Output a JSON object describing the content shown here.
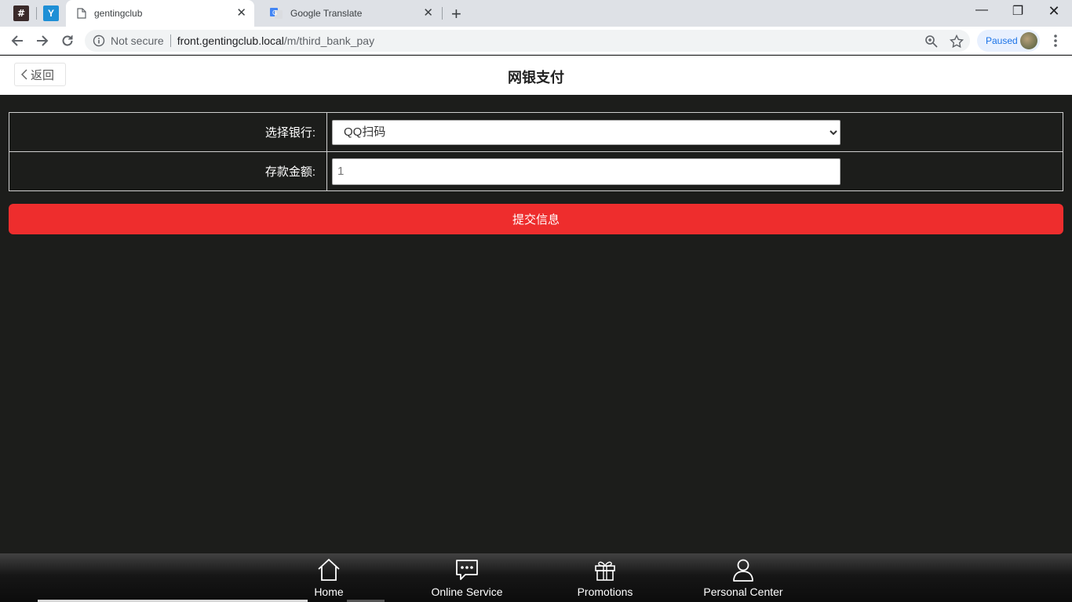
{
  "browser": {
    "pinned_tabs": [
      {
        "icon": "hash-icon",
        "glyph": "#"
      },
      {
        "icon": "y-logo-icon",
        "glyph": "Y"
      }
    ],
    "tabs": [
      {
        "title": "gentingclub",
        "icon": "page-icon",
        "active": true
      },
      {
        "title": "Google Translate",
        "icon": "google-translate-icon",
        "active": false
      }
    ],
    "address": {
      "security_label": "Not secure",
      "url_host": "front.gentingclub.local",
      "url_path": "/m/third_bank_pay"
    },
    "profile": {
      "status": "Paused"
    }
  },
  "header": {
    "back_label": "返回",
    "title": "网银支付"
  },
  "form": {
    "bank_label": "选择银行:",
    "bank_selected": "QQ扫码",
    "amount_label": "存款金额:",
    "amount_value": "1"
  },
  "submit_label": "提交信息",
  "bottom_nav": {
    "items": [
      {
        "label": "Home",
        "icon": "home-icon"
      },
      {
        "label": "Online Service",
        "icon": "chat-icon"
      },
      {
        "label": "Promotions",
        "icon": "gift-icon"
      },
      {
        "label": "Personal Center",
        "icon": "user-icon"
      }
    ]
  },
  "colors": {
    "page_bg": "#1c1d1b",
    "submit_bg": "#ee2d2d",
    "header_bg": "#ffffff"
  }
}
